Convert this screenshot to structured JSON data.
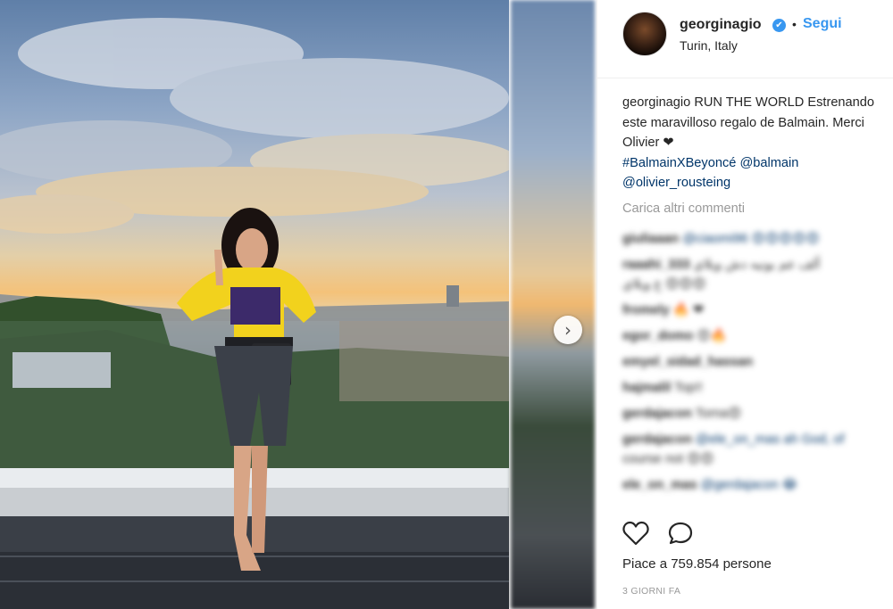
{
  "post": {
    "username": "georginagio",
    "verified_mark": "✔",
    "separator": "•",
    "follow_label": "Segui",
    "location": "Turin, Italy"
  },
  "caption": {
    "username": "georginagio",
    "text": "RUN THE WORLD Estrenando este maravilloso regalo de Balmain. Merci Olivier",
    "heart": "❤",
    "hashtag": "#BalmainXBeyoncé",
    "mention1": "@balmain",
    "mention2": "@olivier_rousteing"
  },
  "load_more_label": "Carica altri commenti",
  "comments": [
    {
      "user": "giuliaaan",
      "text": "@ciaomi96 😍😍😍😍😍"
    },
    {
      "user": "raaahi_333",
      "text": "ألف عم بونيه دش ويلاي"
    },
    {
      "user": "",
      "text": "ع ويلاي 😍😍😍"
    },
    {
      "user": "fromely",
      "text": "🔥 ❤"
    },
    {
      "user": "egor_domo",
      "text": "😍🔥"
    },
    {
      "user": "emyel_sidad_hassan",
      "text": ""
    },
    {
      "user": "hajmalil",
      "text": "Top!!"
    },
    {
      "user": "gerdajacon",
      "text": "Torna😍"
    },
    {
      "user": "gerdajacon",
      "text": "@ele_on_mas ah God, of"
    },
    {
      "user": "",
      "text": "course not 😍😍"
    },
    {
      "user": "ele_on_mas",
      "text": "@gerdajacon 😂"
    }
  ],
  "actions": {
    "like_icon": "heart-outline-icon",
    "comment_icon": "speech-bubble-icon"
  },
  "likes_text": "Piace a 759.854 persone",
  "timestamp": "3 GIORNI FA",
  "carousel": {
    "next_icon": "chevron-right-icon",
    "next_glyph": "›"
  },
  "colors": {
    "link": "#003569",
    "accent": "#3897f0",
    "muted": "#999999"
  }
}
